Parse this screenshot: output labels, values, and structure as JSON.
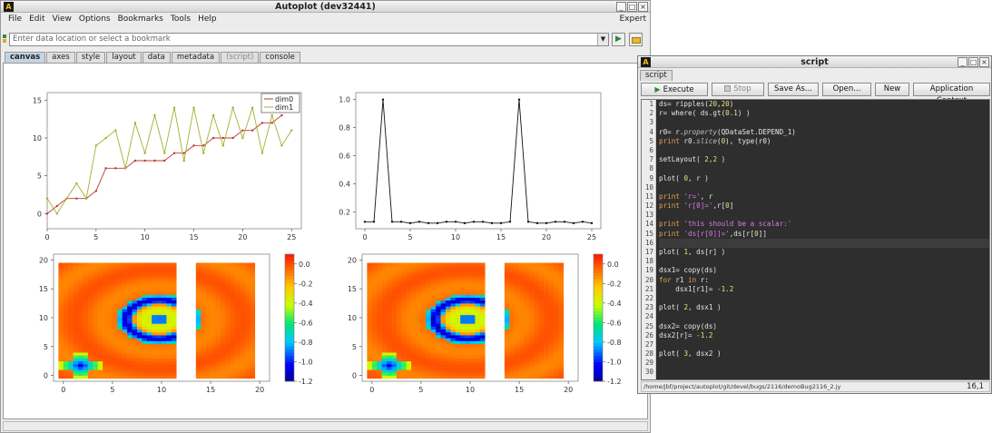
{
  "main_window": {
    "title": "Autoplot (dev32441)",
    "menu": [
      "File",
      "Edit",
      "View",
      "Options",
      "Bookmarks",
      "Tools",
      "Help"
    ],
    "menu_right": "Expert",
    "address": {
      "placeholder": "Enter data location or select a bookmark",
      "value": ""
    },
    "tabs": [
      {
        "label": "canvas",
        "active": true
      },
      {
        "label": "axes"
      },
      {
        "label": "style"
      },
      {
        "label": "layout"
      },
      {
        "label": "data"
      },
      {
        "label": "metadata"
      },
      {
        "label": "(script)",
        "dim": true
      },
      {
        "label": "console"
      }
    ]
  },
  "chart_data": [
    {
      "type": "line",
      "xlim": [
        0,
        26
      ],
      "ylim": [
        -2,
        16
      ],
      "xticks": [
        "0",
        "5",
        "10",
        "15",
        "20",
        "25"
      ],
      "yticks": [
        "0",
        "5",
        "10",
        "15"
      ],
      "legend": "top-right",
      "series": [
        {
          "name": "dim0",
          "color": "#c0392b",
          "x": [
            0,
            1,
            2,
            3,
            4,
            5,
            6,
            7,
            8,
            9,
            10,
            11,
            12,
            13,
            14,
            15,
            16,
            17,
            18,
            19,
            20,
            21,
            22,
            23,
            24
          ],
          "y": [
            0,
            1,
            2,
            2,
            2,
            3,
            6,
            6,
            6,
            7,
            7,
            7,
            7,
            8,
            8,
            9,
            9,
            10,
            10,
            10,
            11,
            11,
            12,
            12,
            13
          ]
        },
        {
          "name": "dim1",
          "color": "#a4b030",
          "x": [
            0,
            1,
            2,
            3,
            4,
            5,
            6,
            7,
            8,
            9,
            10,
            11,
            12,
            13,
            14,
            15,
            16,
            17,
            18,
            19,
            20,
            21,
            22,
            23,
            24,
            25
          ],
          "y": [
            2,
            0,
            2,
            4,
            2,
            9,
            10,
            11,
            6,
            12,
            8,
            13,
            8,
            14,
            7,
            14,
            8,
            13,
            9,
            14,
            10,
            14,
            8,
            13,
            9,
            11
          ]
        }
      ]
    },
    {
      "type": "line",
      "xlim": [
        -1,
        26
      ],
      "ylim": [
        0.08,
        1.05
      ],
      "xticks": [
        "0",
        "5",
        "10",
        "15",
        "20",
        "25"
      ],
      "yticks": [
        "0.2",
        "0.4",
        "0.6",
        "0.8",
        "1.0"
      ],
      "series": [
        {
          "name": "",
          "color": "#111111",
          "x": [
            0,
            1,
            2,
            3,
            4,
            5,
            6,
            7,
            8,
            9,
            10,
            11,
            12,
            13,
            14,
            15,
            16,
            17,
            18,
            19,
            20,
            21,
            22,
            23,
            24,
            25
          ],
          "y": [
            0.13,
            0.13,
            1.0,
            0.13,
            0.13,
            0.12,
            0.13,
            0.12,
            0.12,
            0.13,
            0.13,
            0.12,
            0.13,
            0.13,
            0.12,
            0.12,
            0.13,
            1.0,
            0.13,
            0.12,
            0.12,
            0.13,
            0.13,
            0.12,
            0.13,
            0.12
          ]
        }
      ]
    },
    {
      "type": "heatmap",
      "xlim": [
        -1,
        21
      ],
      "ylim": [
        -1,
        21
      ],
      "xticks": [
        "0",
        "5",
        "10",
        "15",
        "20"
      ],
      "yticks": [
        "0",
        "5",
        "10",
        "15",
        "20"
      ],
      "colorbar": {
        "range": [
          -1.2,
          0.1
        ],
        "ticks": [
          "0.0",
          "-0.2",
          "-0.4",
          "-0.6",
          "-0.8",
          "-1.0",
          "-1.2"
        ]
      },
      "missing_columns": [
        12,
        13
      ]
    },
    {
      "type": "heatmap",
      "xlim": [
        -1,
        21
      ],
      "ylim": [
        -1,
        21
      ],
      "xticks": [
        "0",
        "5",
        "10",
        "15",
        "20"
      ],
      "yticks": [
        "0",
        "5",
        "10",
        "15",
        "20"
      ],
      "colorbar": {
        "range": [
          -1.2,
          0.1
        ],
        "ticks": [
          "0.0",
          "-0.2",
          "-0.4",
          "-0.6",
          "-0.8",
          "-1.0",
          "-1.2"
        ]
      },
      "missing_columns": [
        12,
        13
      ]
    }
  ],
  "script_window": {
    "title": "script",
    "tab": "script",
    "buttons": {
      "execute": "Execute",
      "stop": "Stop",
      "save_as": "Save As...",
      "open": "Open...",
      "new": "New",
      "context": "Application Context"
    },
    "status_path": "/home/jbf/project/autoplot/git/devel/bugs/2116/demoBug2116_2.jy",
    "cursor_pos": "16,1",
    "current_line": 16,
    "code": [
      "ds= ripples(20,20)",
      "r= where( ds.gt(0.1) )",
      "",
      "r0= r.property(QDataSet.DEPEND_1)",
      "print r0.slice(0), type(r0)",
      "",
      "setLayout( 2,2 )",
      "",
      "plot( 0, r )",
      "",
      "print 'r=', r",
      "print 'r[0]=',r[0]",
      "",
      "print 'this should be a scalar:'",
      "print 'ds[r[0]]=',ds[r[0]]",
      "",
      "plot( 1, ds[r] )",
      "",
      "dsx1= copy(ds)",
      "for r1 in r:",
      "    dsx1[r1]= -1.2",
      "",
      "plot( 2, dsx1 )",
      "",
      "dsx2= copy(ds)",
      "dsx2[r]= -1.2",
      "",
      "plot( 3, dsx2 )",
      "",
      ""
    ]
  }
}
